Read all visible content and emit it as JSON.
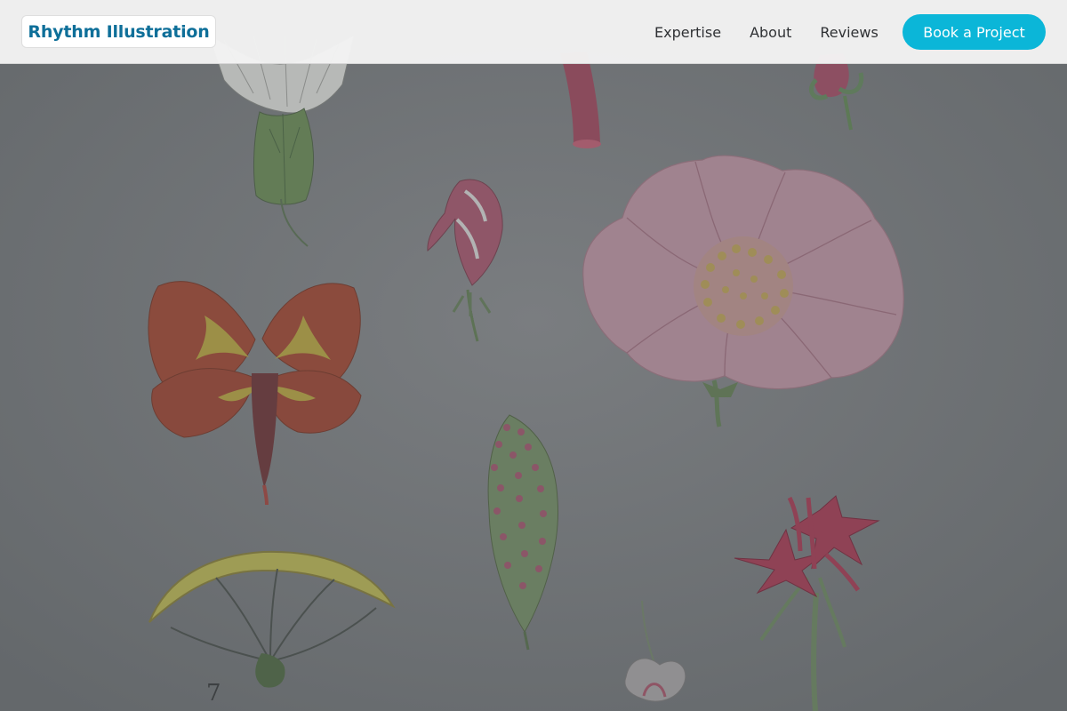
{
  "header": {
    "brand": "Rhythm Illustration",
    "nav": [
      {
        "label": "Expertise"
      },
      {
        "label": "About"
      },
      {
        "label": "Reviews"
      }
    ],
    "cta_label": "Book a Project"
  },
  "colors": {
    "brand_text": "#0e6f99",
    "accent": "#0bb6d8",
    "nav_background": "#f4f4f4",
    "hero_background": "#6f7377"
  },
  "hero": {
    "artwork_label": "7"
  }
}
